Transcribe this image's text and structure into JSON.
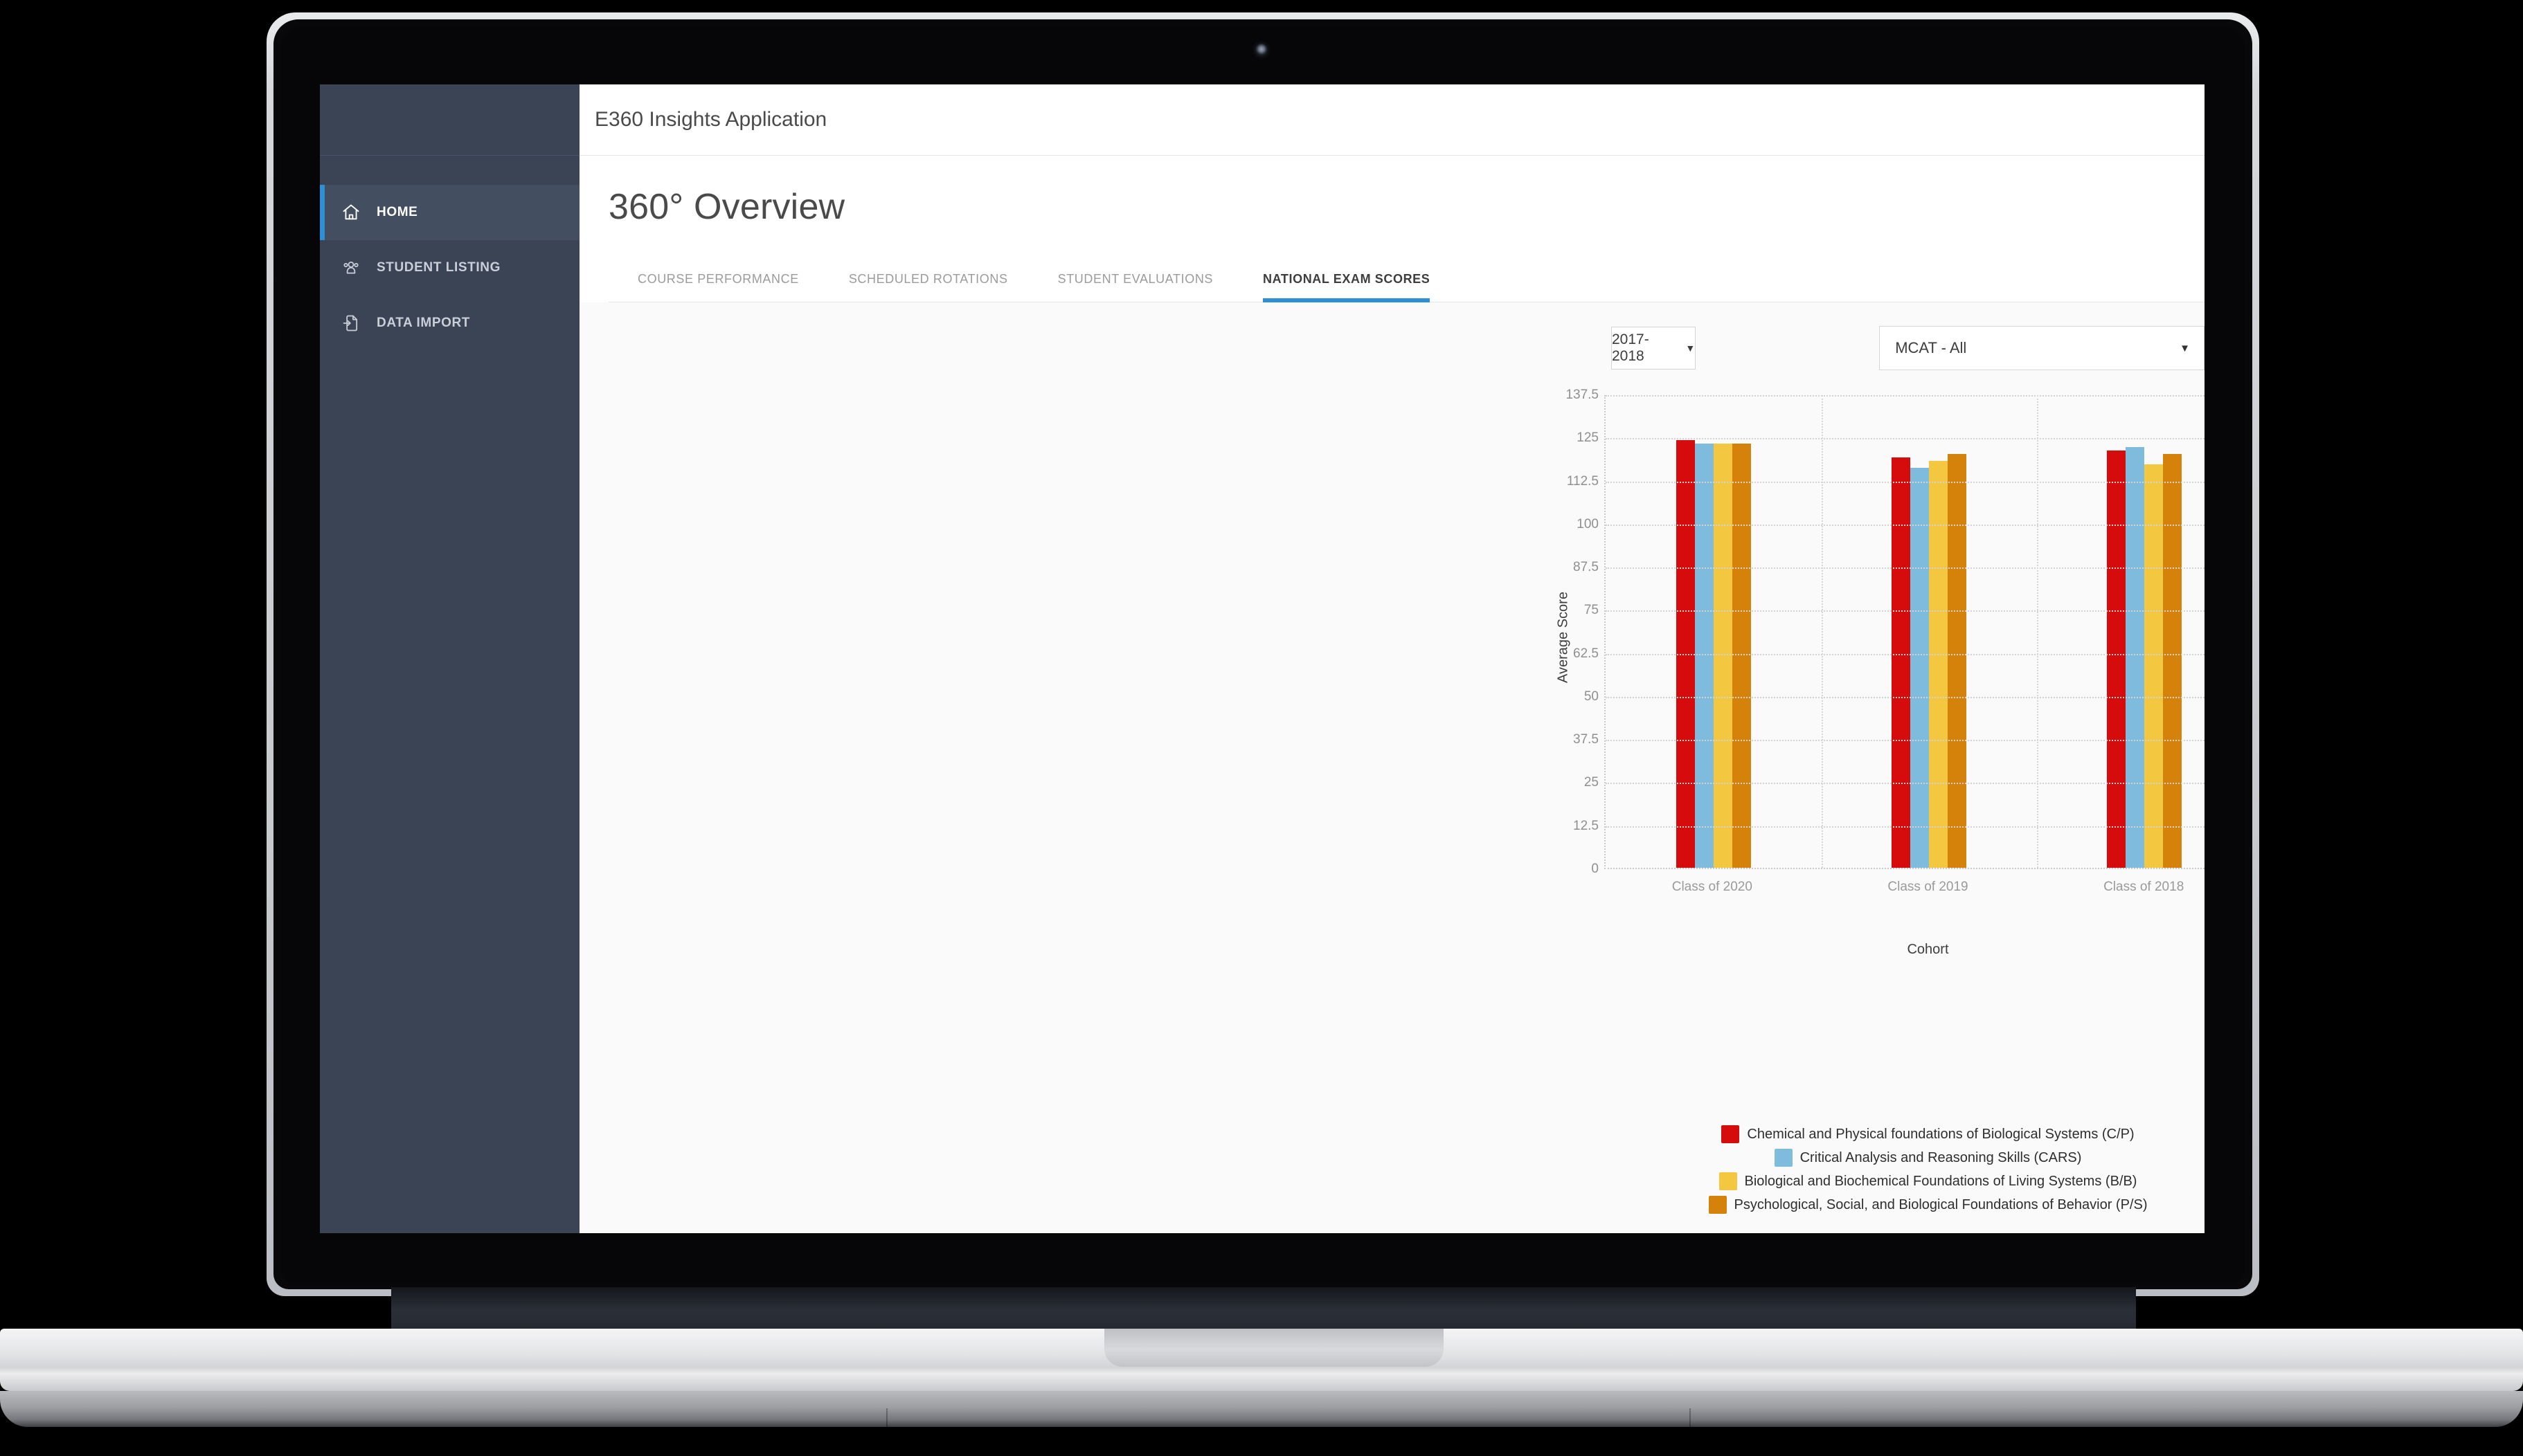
{
  "app": {
    "window_title": "E360 Insights Application",
    "page_title": "360° Overview"
  },
  "sidebar": {
    "items": [
      {
        "label": "HOME",
        "icon": "home-icon",
        "active": true
      },
      {
        "label": "STUDENT LISTING",
        "icon": "people-icon",
        "active": false
      },
      {
        "label": "DATA IMPORT",
        "icon": "file-import-icon",
        "active": false
      }
    ]
  },
  "tabs": [
    {
      "label": "COURSE PERFORMANCE",
      "active": false
    },
    {
      "label": "SCHEDULED ROTATIONS",
      "active": false
    },
    {
      "label": "STUDENT EVALUATIONS",
      "active": false
    },
    {
      "label": "NATIONAL EXAM SCORES",
      "active": true
    }
  ],
  "filters": {
    "year_select": {
      "value": "2017-2018",
      "caret": "▼"
    },
    "exam_select": {
      "value": "MCAT - All",
      "caret": "▼"
    }
  },
  "colors": {
    "accent": "#2f8fd6",
    "sidebar": "#3a4455",
    "sidebar_active": "#434e61",
    "series_cp": "#d60c0c",
    "series_cars": "#7fbbdd",
    "series_bb": "#f3c73f",
    "series_ps": "#d4820a"
  },
  "chart_data": {
    "type": "bar",
    "title": "",
    "xlabel": "Cohort",
    "ylabel": "Average Score",
    "categories": [
      "Class of 2020",
      "Class of 2019",
      "Class of 2018"
    ],
    "ylim": [
      0,
      137.5
    ],
    "yticks": [
      137.5,
      125,
      112.5,
      100,
      87.5,
      75,
      62.5,
      50,
      37.5,
      25,
      12.5,
      0
    ],
    "grid": true,
    "legend_position": "bottom",
    "series": [
      {
        "name": "Chemical and Physical foundations of Biological Systems (C/P)",
        "color": "#d60c0c",
        "values": [
          124,
          119,
          121
        ]
      },
      {
        "name": "Critical Analysis and Reasoning Skills (CARS)",
        "color": "#7fbbdd",
        "values": [
          123,
          116,
          122
        ]
      },
      {
        "name": "Biological and Biochemical Foundations of Living Systems (B/B)",
        "color": "#f3c73f",
        "values": [
          123,
          118,
          117
        ]
      },
      {
        "name": "Psychological, Social, and Biological Foundations of Behavior (P/S)",
        "color": "#d4820a",
        "values": [
          123,
          120,
          120
        ]
      }
    ]
  }
}
